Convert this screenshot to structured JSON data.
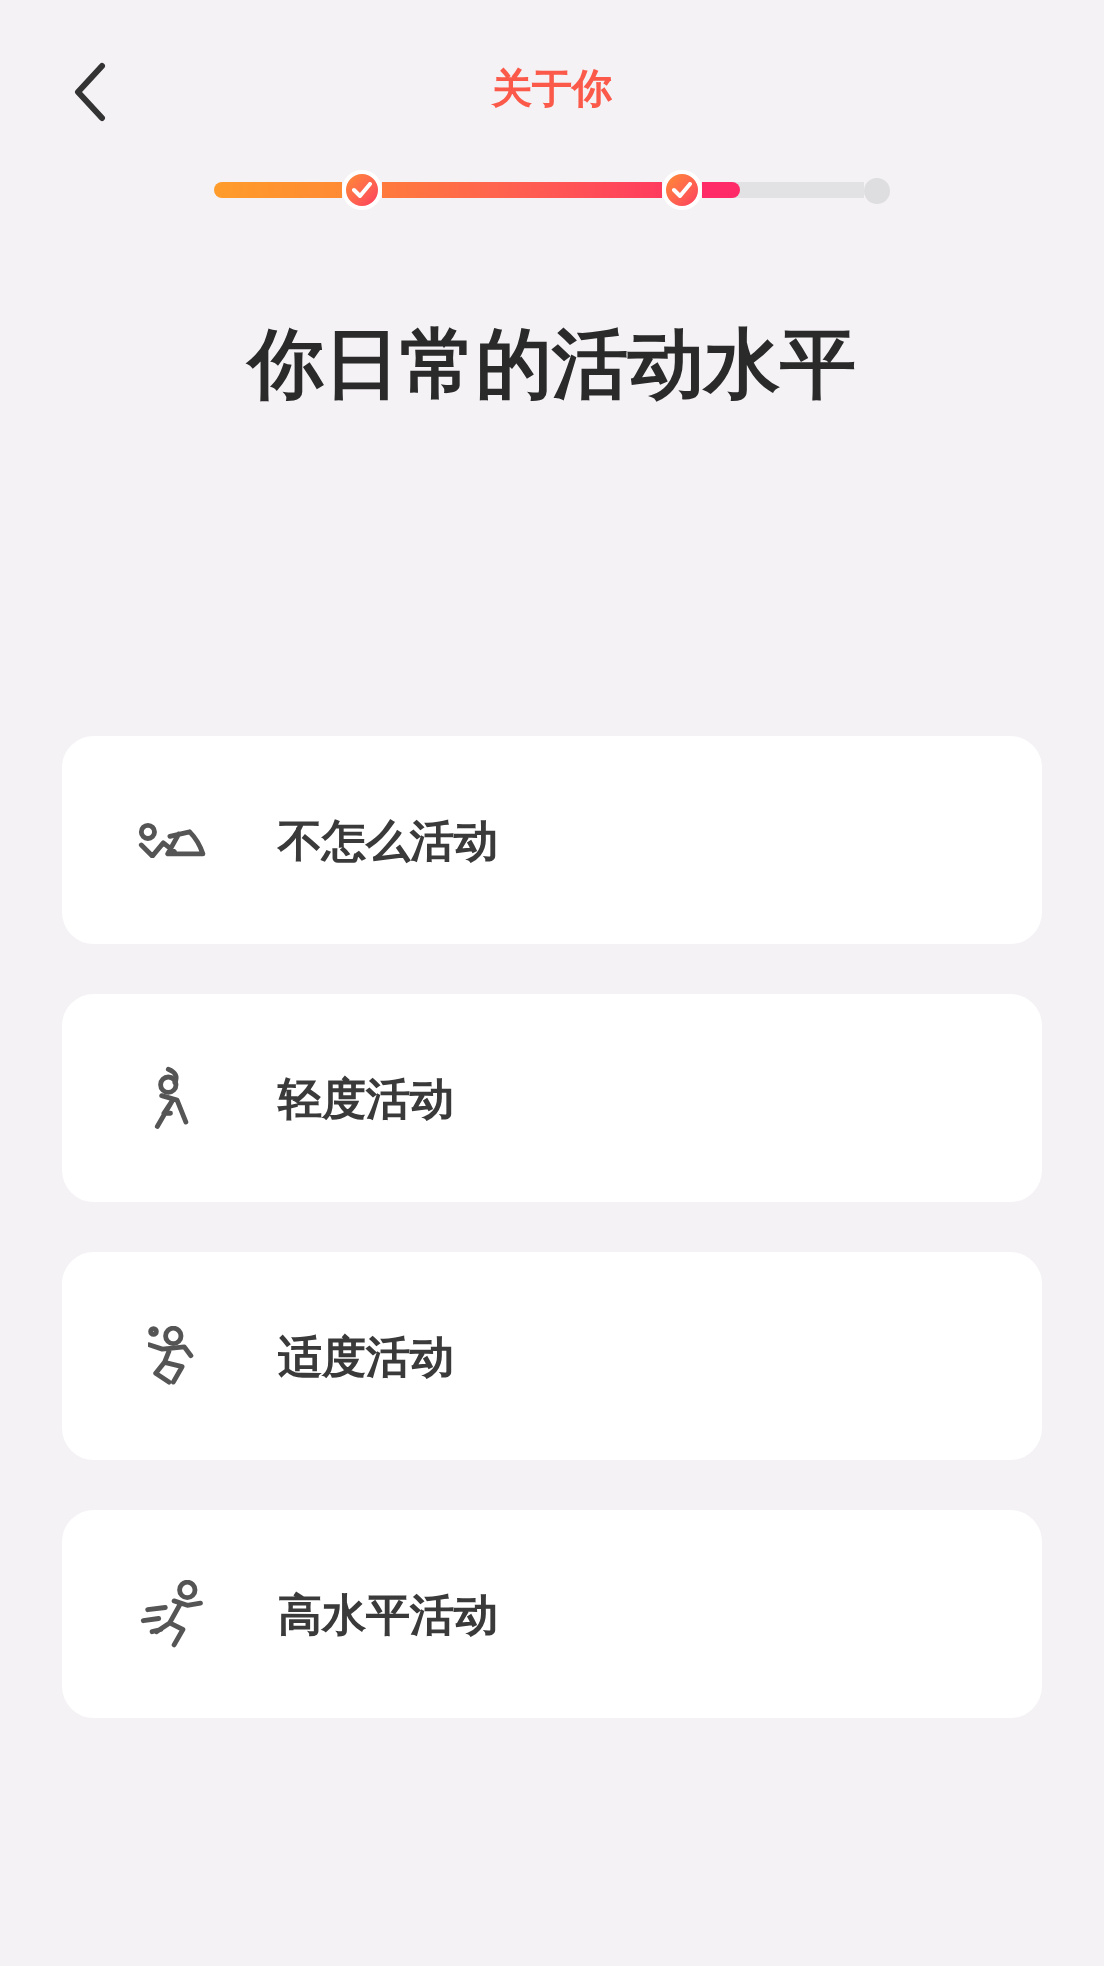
{
  "header": {
    "title": "关于你"
  },
  "progress": {
    "steps": [
      {
        "done": true
      },
      {
        "done": true
      },
      {
        "done": false
      }
    ],
    "level": 0.23
  },
  "heading": "你日常的活动水平",
  "options": [
    {
      "label": "不怎么活动",
      "kind": "lying",
      "selected": false
    },
    {
      "label": "轻度活动",
      "kind": "walking",
      "selected": false
    },
    {
      "label": "适度活动",
      "kind": "jumping",
      "selected": false
    },
    {
      "label": "高水平活动",
      "kind": "running",
      "selected": false
    }
  ]
}
